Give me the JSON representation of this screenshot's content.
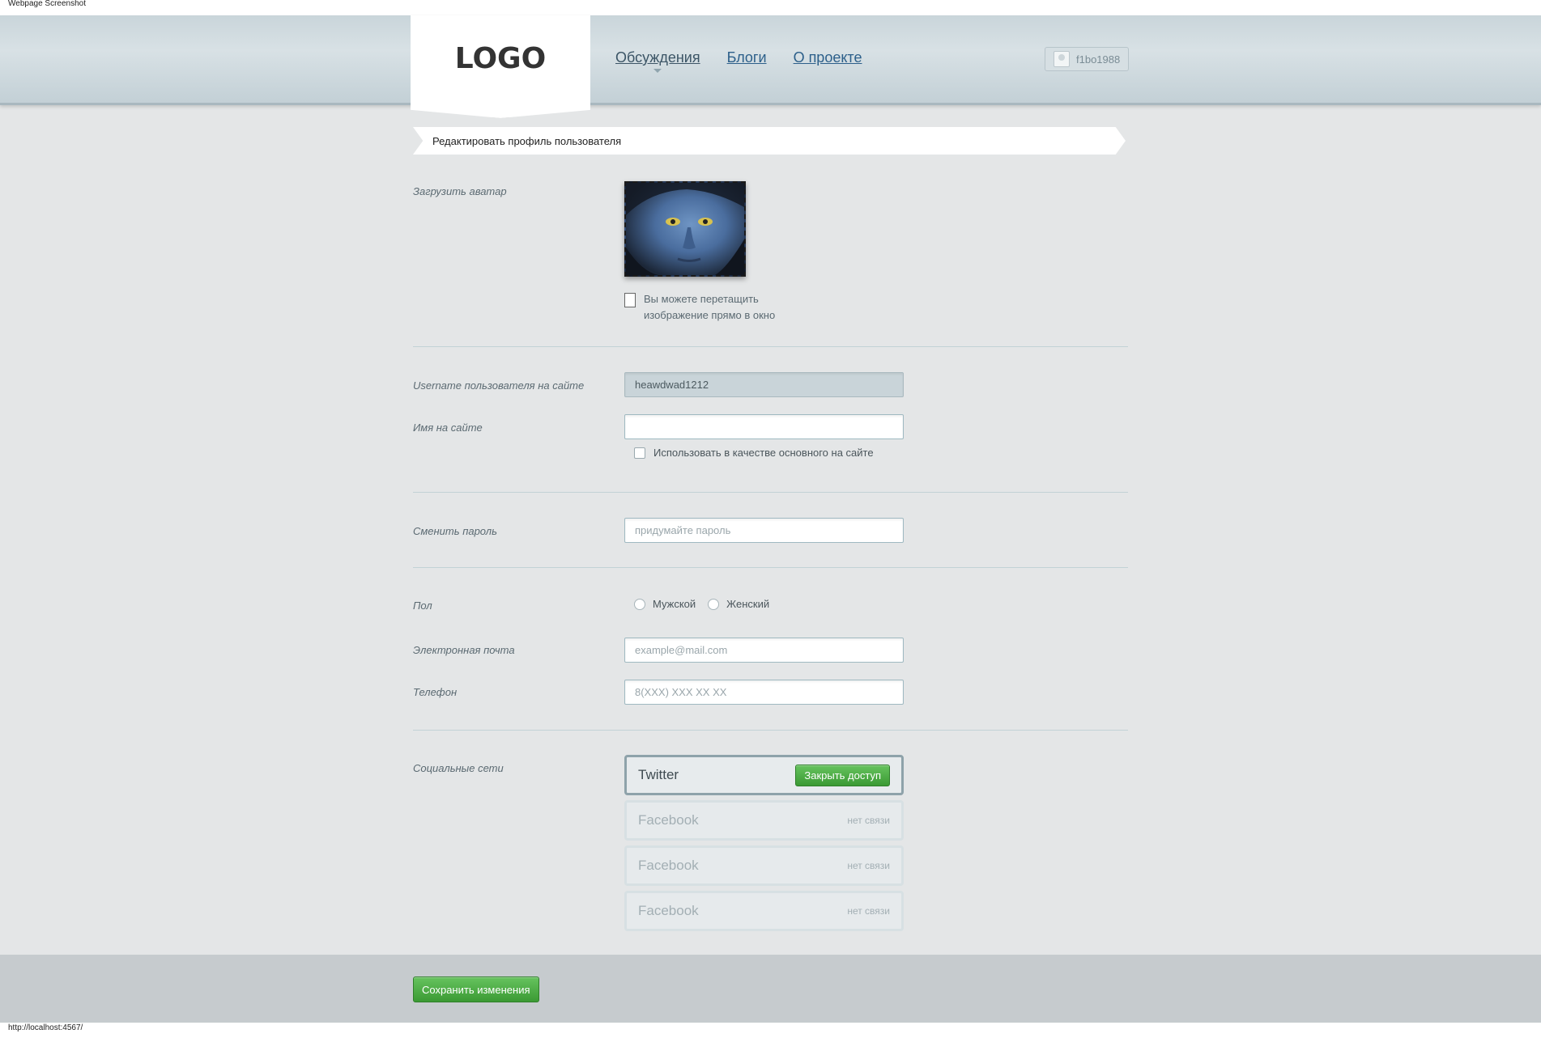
{
  "caption_top": "Webpage Screenshot",
  "logo_text": "LOGO",
  "nav": [
    {
      "label": "Обсуждения",
      "active": true
    },
    {
      "label": "Блоги",
      "active": false
    },
    {
      "label": "О проекте",
      "active": false
    }
  ],
  "user": {
    "name": "f1bo1988"
  },
  "page_heading": "Редактировать профиль пользователя",
  "avatar": {
    "label": "Загрузить аватар",
    "drag_hint": "Вы можете перетащить изображение прямо в окно"
  },
  "username": {
    "label": "Username пользователя на сайте",
    "value": "heawdwad1212"
  },
  "display_name": {
    "label": "Имя на сайте",
    "value": "",
    "checkbox_label": "Использовать в качестве основного на сайте",
    "checked": false
  },
  "password": {
    "label": "Сменить пароль",
    "placeholder": "придумайте пароль"
  },
  "gender": {
    "label": "Пол",
    "options": [
      "Мужской",
      "Женский"
    ],
    "selected": null
  },
  "email": {
    "label": "Электронная почта",
    "placeholder": "example@mail.com"
  },
  "phone": {
    "label": "Телефон",
    "placeholder": "8(XXX) XXX XX XX"
  },
  "social": {
    "label": "Социальные сети",
    "items": [
      {
        "name": "Twitter",
        "connected": true,
        "action_label": "Закрыть доступ"
      },
      {
        "name": "Facebook",
        "connected": false,
        "status": "нет связи"
      },
      {
        "name": "Facebook",
        "connected": false,
        "status": "нет связи"
      },
      {
        "name": "Facebook",
        "connected": false,
        "status": "нет связи"
      }
    ]
  },
  "save_label": "Сохранить изменения",
  "status_url": "http://localhost:4567/",
  "colors": {
    "accent_green": "#4caf45",
    "link_blue": "#2c5f8a",
    "background": "#e4e6e7"
  }
}
